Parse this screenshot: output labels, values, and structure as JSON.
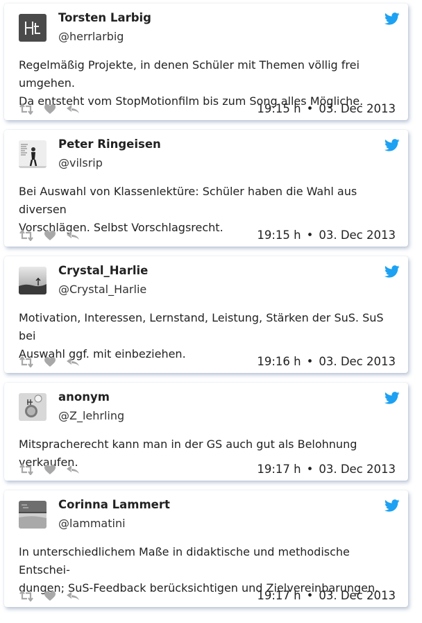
{
  "colors": {
    "accent": "#1da1f2",
    "icon_gray": "#a8a8a8",
    "shadow": "#c3d3ea"
  },
  "tweets": [
    {
      "name": "Torsten Larbig",
      "handle": "@herrlarbig",
      "text_lines": [
        "Regelmäßig Projekte, in denen Schüler mit Themen völlig frei umgehen.",
        "Da entsteht vom StopMotionfilm bis zum Song alles Mögliche."
      ],
      "time": "19:15 h",
      "separator": "•",
      "date": "03. Dec 2013",
      "avatar_icon": "hl-monogram-avatar",
      "avatar_text": "Hl"
    },
    {
      "name": "Peter Ringeisen",
      "handle": "@vilsrip",
      "text_lines": [
        "Bei Auswahl von Klassenlektüre: Schüler haben die Wahl aus diversen",
        "Vorschlägen. Selbst Vorschlagsrecht."
      ],
      "time": "19:15 h",
      "separator": "•",
      "date": "03. Dec 2013",
      "avatar_icon": "person-photo-avatar"
    },
    {
      "name": "Crystal_Harlie",
      "handle": "@Crystal_Harlie",
      "text_lines": [
        "Motivation, Interessen, Lernstand, Leistung, Stärken der SuS. SuS bei",
        "Auswahl ggf. mit einbeziehen."
      ],
      "time": "19:16 h",
      "separator": "•",
      "date": "03. Dec 2013",
      "avatar_icon": "landscape-photo-avatar"
    },
    {
      "name": "anonym",
      "handle": "@Z_lehrling",
      "text_lines": [
        "Mitspracherecht kann man in der GS auch gut als Belohnung verkaufen."
      ],
      "time": "19:17 h",
      "separator": "•",
      "date": "03. Dec 2013",
      "avatar_icon": "badge-photo-avatar"
    },
    {
      "name": "Corinna Lammert",
      "handle": "@lammatini",
      "text_lines": [
        "In unterschiedlichem Maße in didaktische und methodische Entschei-",
        "dungen; SuS-Feedback berücksichtigen und Zielvereinbarungen."
      ],
      "time": "19:17 h",
      "separator": "•",
      "date": "03. Dec 2013",
      "avatar_icon": "beach-photo-avatar"
    }
  ],
  "action_icons": [
    "retweet-icon",
    "like-icon",
    "reply-icon"
  ]
}
